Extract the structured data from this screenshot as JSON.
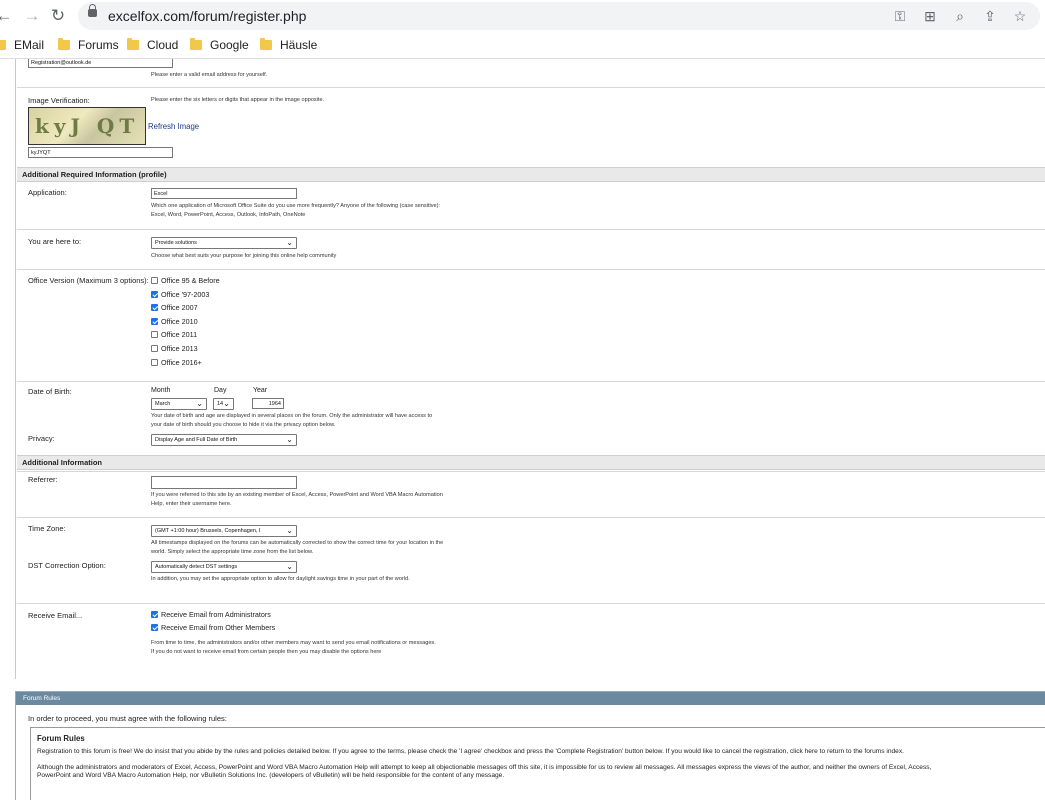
{
  "browser": {
    "url": "excelfox.com/forum/register.php",
    "bookmarks": [
      "EMail",
      "Forums",
      "Cloud",
      "Google",
      "Häusle"
    ]
  },
  "email": {
    "value": "Registration@outlook.de",
    "hint": "Please enter a valid email address for yourself."
  },
  "image_verification": {
    "label": "Image Verification:",
    "hint": "Please enter the six letters or digits that appear in the image opposite.",
    "captcha_text": "kyJ QT",
    "refresh": "Refresh Image",
    "value": "kyJYQT"
  },
  "section_required": "Additional Required Information (profile)",
  "application": {
    "label": "Application:",
    "value": "Excel",
    "hint": "Which one application of Microsoft Office Suite do you use more frequently? Anyone of the following (case sensitive): Excel, Word, PowerPoint, Access, Outlook, InfoPath, OneNote"
  },
  "here_to": {
    "label": "You are here to:",
    "value": "Provide solutions",
    "hint": "Choose what best suits your purpose for joining this online help community"
  },
  "office_version": {
    "label": "Office Version (Maximum 3 options):",
    "options": [
      {
        "label": "Office 95 & Before",
        "checked": false
      },
      {
        "label": "Office '97-2003",
        "checked": true
      },
      {
        "label": "Office 2007",
        "checked": true
      },
      {
        "label": "Office 2010",
        "checked": true
      },
      {
        "label": "Office 2011",
        "checked": false
      },
      {
        "label": "Office 2013",
        "checked": false
      },
      {
        "label": "Office 2016+",
        "checked": false
      }
    ]
  },
  "dob": {
    "label": "Date of Birth:",
    "month_label": "Month",
    "day_label": "Day",
    "year_label": "Year",
    "month": "March",
    "day": "14",
    "year": "1964",
    "hint": "Your date of birth and age are displayed in several places on the forum. Only the administrator will have access to your date of birth should you choose to hide it via the privacy option below."
  },
  "privacy": {
    "label": "Privacy:",
    "value": "Display Age and Full Date of Birth"
  },
  "section_additional": "Additional Information",
  "referrer": {
    "label": "Referrer:",
    "value": "",
    "hint": "If you were referred to this site by an existing member of Excel, Access, PowerPoint and Word VBA Macro Automation Help, enter their username here."
  },
  "timezone": {
    "label": "Time Zone:",
    "value": "(GMT +1:00 hour) Brussels, Copenhagen, I",
    "hint": "All timestamps displayed on the forums can be automatically corrected to show the correct time for your location in the world. Simply select the appropriate time zone from the list below."
  },
  "dst": {
    "label": "DST Correction Option:",
    "value": "Automatically detect DST settings",
    "hint": "In addition, you may set the appropriate option to allow for daylight savings time in your part of the world."
  },
  "receive_email": {
    "label": "Receive Email...",
    "options": [
      {
        "label": "Receive Email from Administrators",
        "checked": true
      },
      {
        "label": "Receive Email from Other Members",
        "checked": true
      }
    ],
    "hint": "From time to time, the administrators and/or other members may want to send you email notifications or messages. If you do not want to receive email from certain people then you may disable the options here"
  },
  "forum_rules": {
    "header": "Forum Rules",
    "intro": "In order to proceed, you must agree with the following rules:",
    "title": "Forum Rules",
    "para1": "Registration to this forum is free! We do insist that you abide by the rules and policies detailed below. If you agree to the terms, please check the 'I agree' checkbox and press the 'Complete Registration' button below. If you would like to cancel the registration, click here to return to the forums index.",
    "para2a": "Although the administrators and moderators of Excel, Access, PowerPoint and Word VBA Macro Automation Help will attempt to keep all objectionable messages off this site, it is impossible for us to review all messages. All messages express the views of the author, and neither the owners of Excel, Access,",
    "para2b": "PowerPoint and Word VBA Macro Automation Help, nor vBulletin Solutions Inc. (developers of vBulletin) will be held responsible for the content of any message."
  }
}
